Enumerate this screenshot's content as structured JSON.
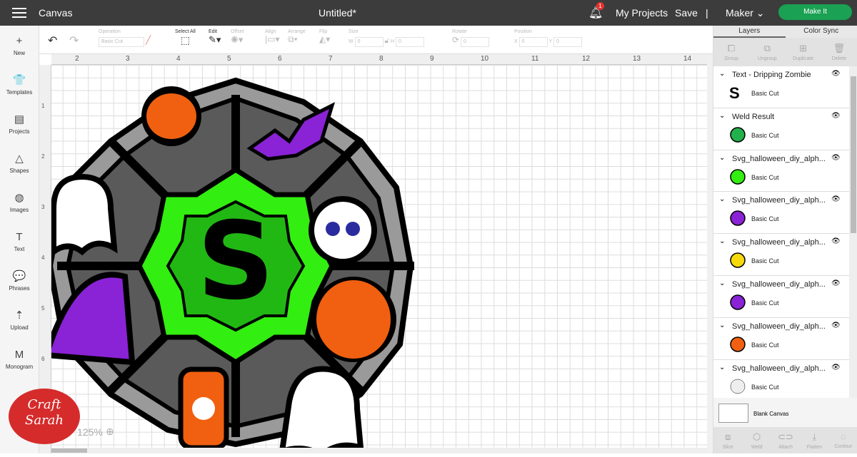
{
  "topbar": {
    "menu_icon": "hamburger-icon",
    "app": "Canvas",
    "title": "Untitled*",
    "notifications": "1",
    "my_projects": "My Projects",
    "save": "Save",
    "separator": "|",
    "machine": "Maker",
    "make_it": "Make It"
  },
  "sidebar": [
    {
      "icon": "+",
      "label": "New"
    },
    {
      "icon": "👕",
      "label": "Templates"
    },
    {
      "icon": "▤",
      "label": "Projects"
    },
    {
      "icon": "△",
      "label": "Shapes"
    },
    {
      "icon": "◍",
      "label": "Images"
    },
    {
      "icon": "T",
      "label": "Text"
    },
    {
      "icon": "💬",
      "label": "Phrases"
    },
    {
      "icon": "⇡",
      "label": "Upload"
    },
    {
      "icon": "M",
      "label": "Monogram"
    }
  ],
  "toolbar": {
    "operation_label": "Operation",
    "operation_value": "Basic Cut",
    "select_all": "Select All",
    "edit": "Edit",
    "offset": "Offset",
    "align": "Align",
    "arrange": "Arrange",
    "flip": "Flip",
    "size": "Size",
    "w_label": "W",
    "w_value": "0",
    "h_label": "H",
    "h_value": "0",
    "rotate": "Rotate",
    "rotate_value": "0",
    "position": "Position",
    "x_label": "X",
    "x_value": "0",
    "y_label": "Y",
    "y_value": "0"
  },
  "ruler": {
    "h": [
      "2",
      "3",
      "4",
      "5",
      "6",
      "7",
      "8",
      "9",
      "10",
      "11",
      "12",
      "13",
      "14"
    ],
    "v": [
      "1",
      "2",
      "3",
      "4",
      "5",
      "6"
    ]
  },
  "canvas": {
    "zoom": "125%",
    "logo_text": "Craft with Sarah"
  },
  "panel": {
    "tabs": [
      "Layers",
      "Color Sync"
    ],
    "actions": [
      "Group",
      "Ungroup",
      "Duplicate",
      "Delete"
    ],
    "layers": [
      {
        "name": "Text - Dripping Zombie",
        "op": "Basic Cut",
        "color": "#000000"
      },
      {
        "name": "Weld Result",
        "op": "Basic Cut",
        "color": "#22b14c"
      },
      {
        "name": "Svg_halloween_diy_alph...",
        "op": "Basic Cut",
        "color": "#33ee11"
      },
      {
        "name": "Svg_halloween_diy_alph...",
        "op": "Basic Cut",
        "color": "#8a22d6"
      },
      {
        "name": "Svg_halloween_diy_alph...",
        "op": "Basic Cut",
        "color": "#f5d90a"
      },
      {
        "name": "Svg_halloween_diy_alph...",
        "op": "Basic Cut",
        "color": "#8a22d6"
      },
      {
        "name": "Svg_halloween_diy_alph...",
        "op": "Basic Cut",
        "color": "#f06010"
      },
      {
        "name": "Svg_halloween_diy_alph...",
        "op": "Basic Cut",
        "color": "#eeeeee"
      }
    ],
    "blank": "Blank Canvas",
    "bottom": [
      "Slice",
      "Weld",
      "Attach",
      "Flatten",
      "Contour"
    ]
  }
}
